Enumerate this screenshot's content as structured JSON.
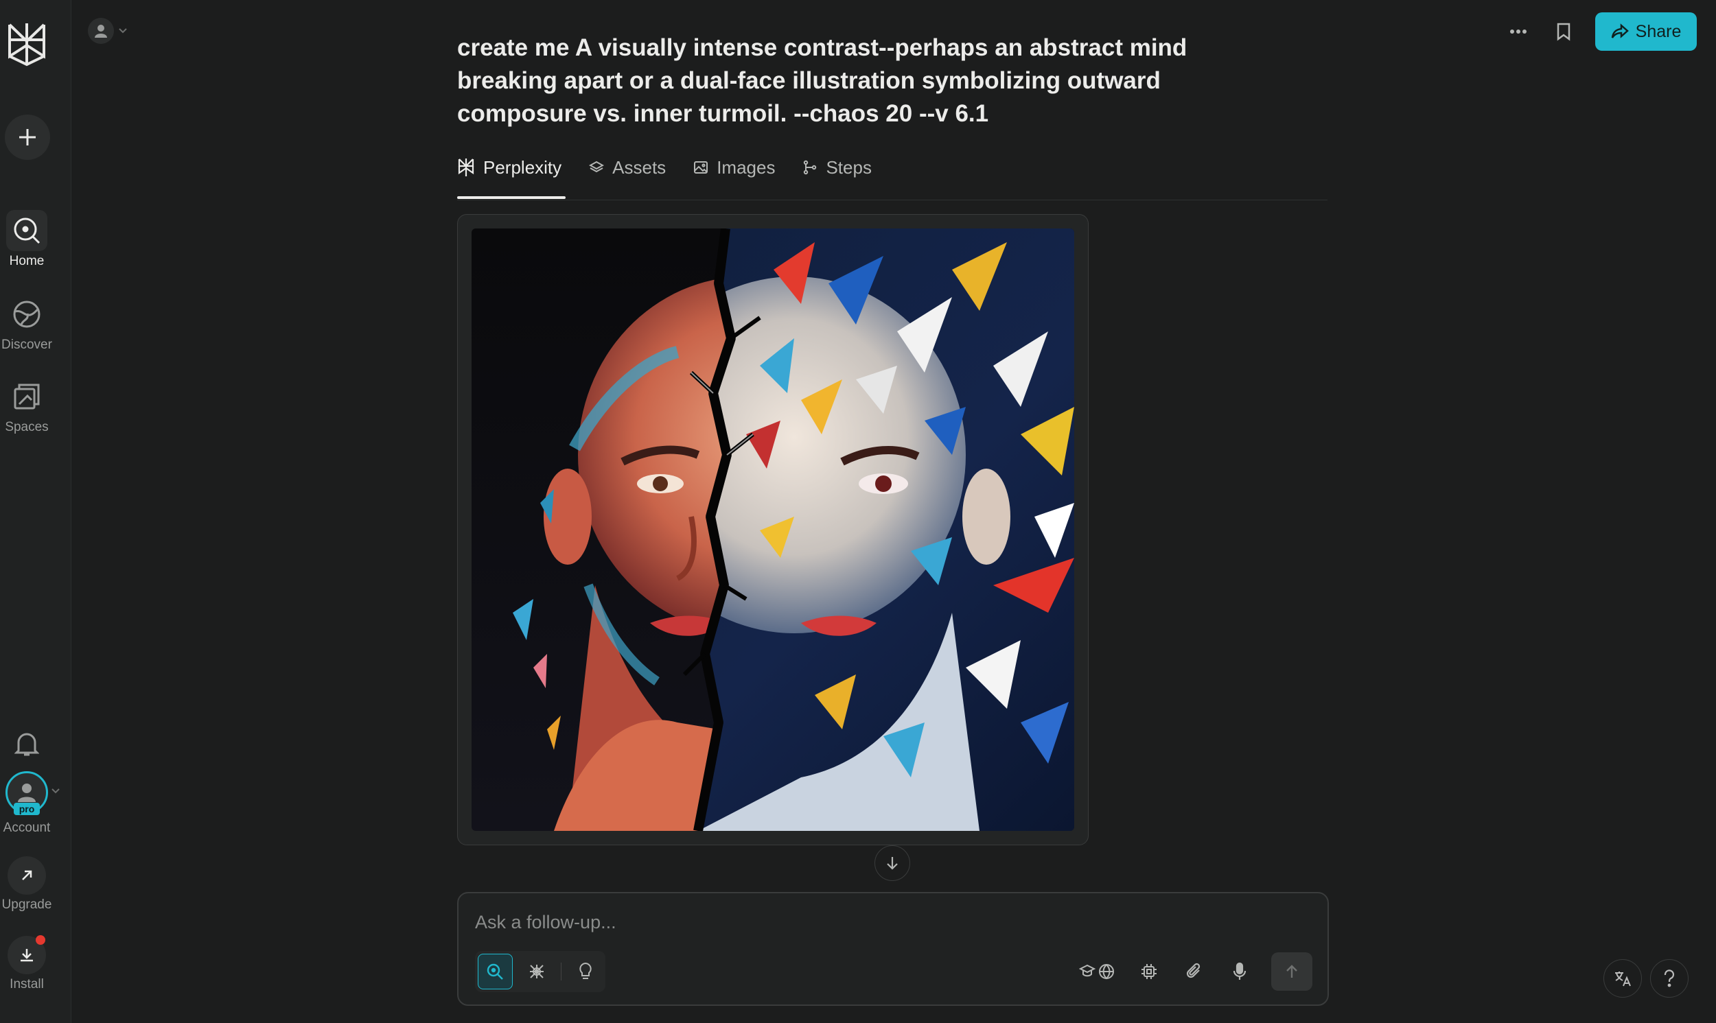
{
  "sidebar": {
    "items": [
      {
        "label": "Home",
        "icon": "search-icon"
      },
      {
        "label": "Discover",
        "icon": "globe-icon"
      },
      {
        "label": "Spaces",
        "icon": "spaces-icon"
      }
    ],
    "account_label": "Account",
    "pro_badge": "pro",
    "upgrade_label": "Upgrade",
    "install_label": "Install"
  },
  "header": {
    "share_label": "Share"
  },
  "thread": {
    "query": "create me A visually intense contrast--perhaps an abstract mind breaking apart or a dual-face illustration symbolizing outward composure vs. inner turmoil. --chaos 20 --v 6.1"
  },
  "tabs": [
    {
      "label": "Perplexity",
      "icon": "perplexity-icon"
    },
    {
      "label": "Assets",
      "icon": "layers-icon"
    },
    {
      "label": "Images",
      "icon": "image-icon"
    },
    {
      "label": "Steps",
      "icon": "steps-icon"
    }
  ],
  "composer": {
    "placeholder": "Ask a follow-up..."
  },
  "colors": {
    "accent": "#20b8cd",
    "background": "#1c1d1d",
    "sidebar": "#202222",
    "notification": "#e5392f"
  }
}
